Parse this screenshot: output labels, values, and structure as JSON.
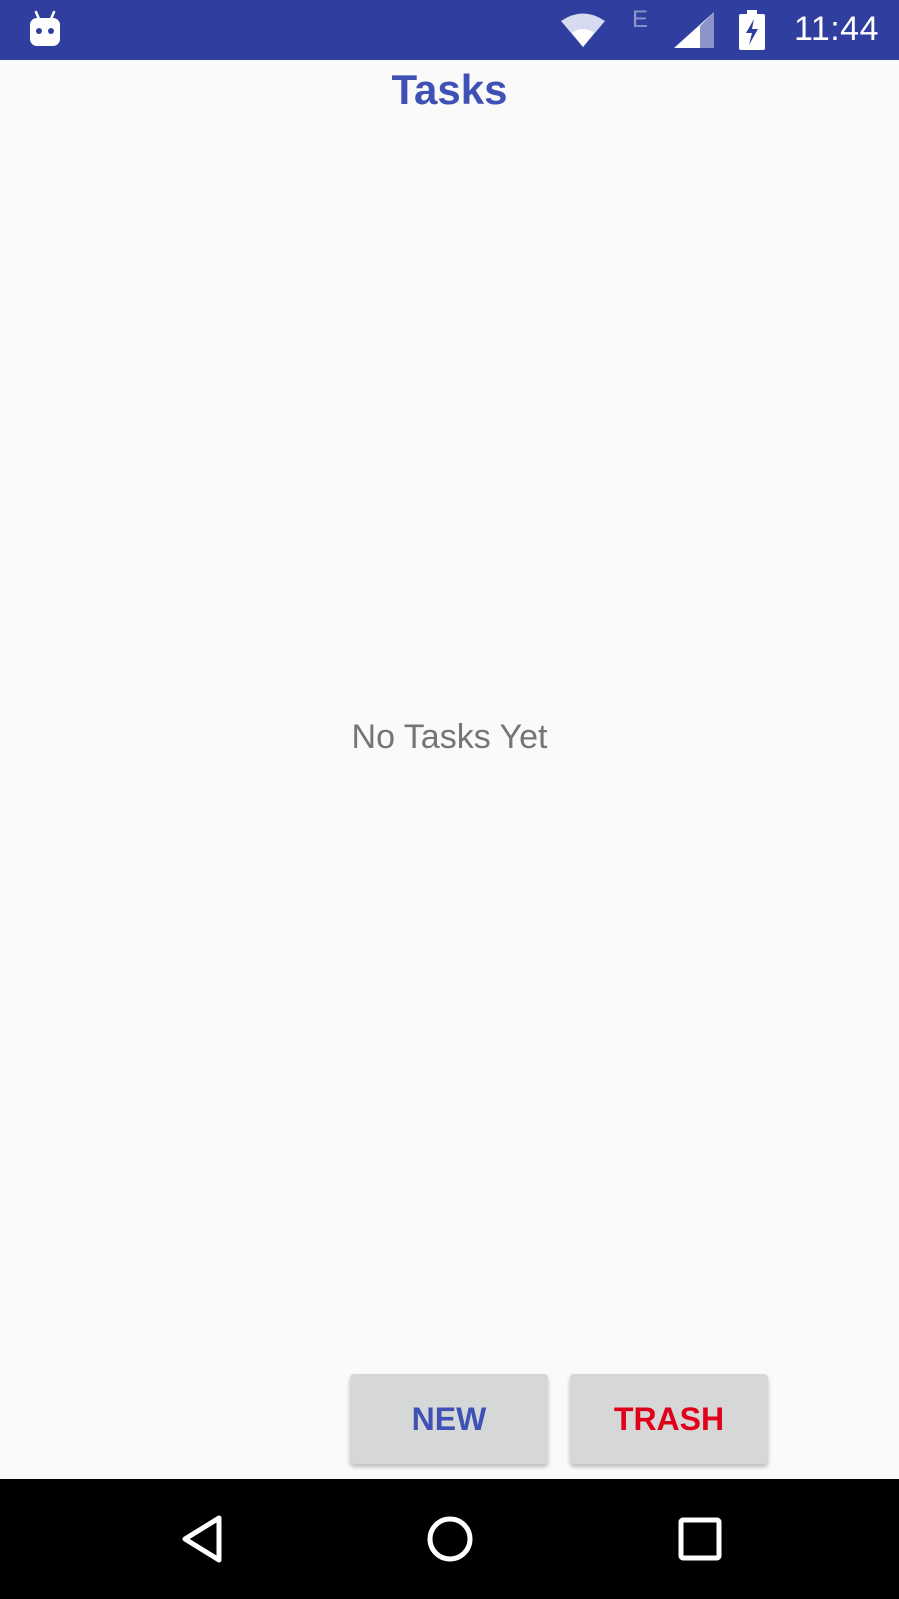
{
  "status_bar": {
    "time": "11:44",
    "network_type": "E",
    "icons": [
      "notification-android-icon",
      "wifi-icon",
      "cell-signal-icon",
      "battery-charging-icon"
    ],
    "background_color": "#303f9f"
  },
  "screen": {
    "title": "Tasks",
    "empty_message": "No Tasks Yet"
  },
  "actions": {
    "new_label": "NEW",
    "trash_label": "TRASH"
  },
  "nav_bar": {
    "icons": [
      "back-icon",
      "home-icon",
      "recents-icon"
    ]
  },
  "colors": {
    "accent": "#3f51b5",
    "danger": "#e0001a",
    "button_bg": "#d6d7d7"
  }
}
